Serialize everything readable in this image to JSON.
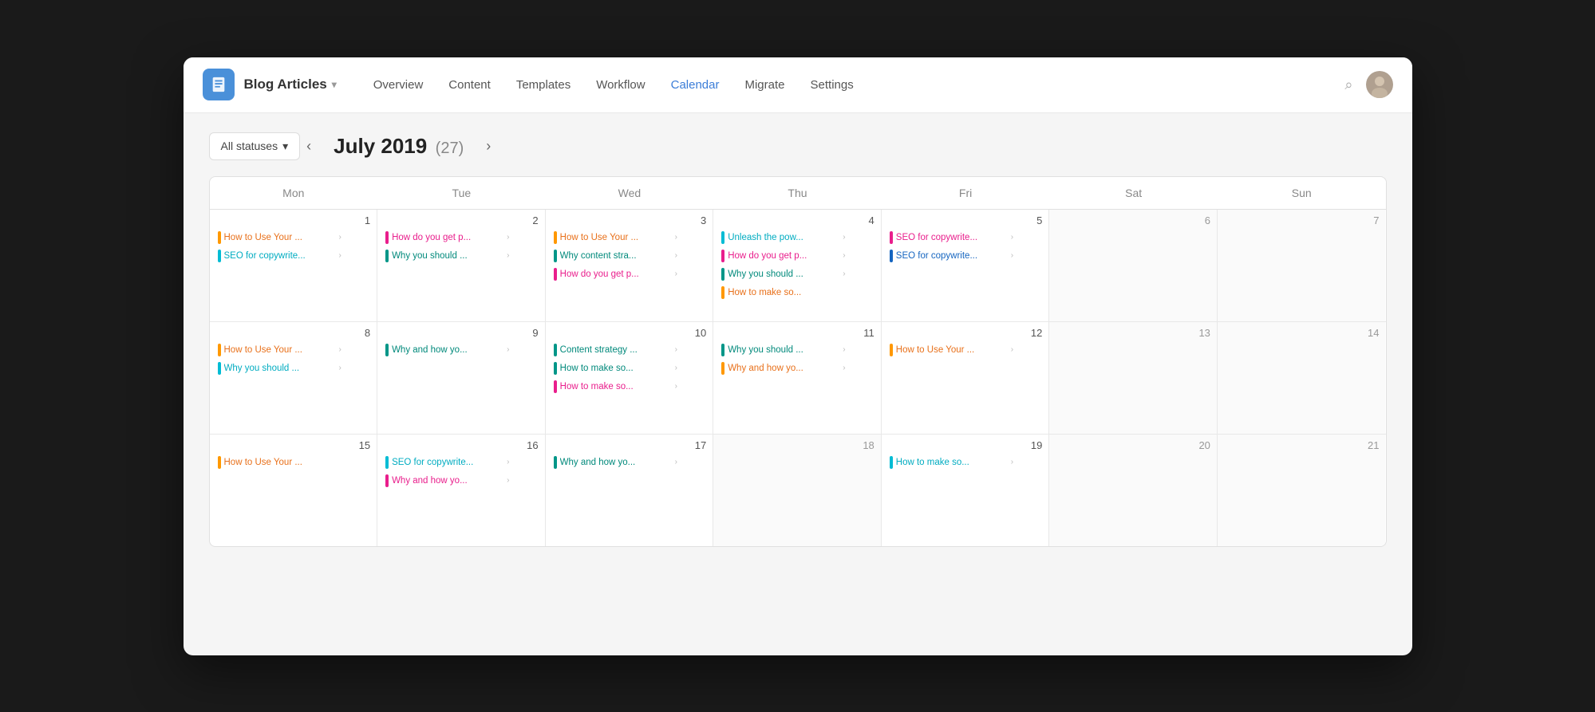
{
  "app": {
    "icon_label": "doc-icon",
    "title": "Blog Articles",
    "nav": [
      {
        "label": "Overview",
        "id": "overview",
        "active": false
      },
      {
        "label": "Content",
        "id": "content",
        "active": false
      },
      {
        "label": "Templates",
        "id": "templates",
        "active": false
      },
      {
        "label": "Workflow",
        "id": "workflow",
        "active": false
      },
      {
        "label": "Calendar",
        "id": "calendar",
        "active": true
      },
      {
        "label": "Migrate",
        "id": "migrate",
        "active": false
      },
      {
        "label": "Settings",
        "id": "settings",
        "active": false
      }
    ]
  },
  "filter": {
    "label": "All statuses",
    "arrow": "▾"
  },
  "calendar": {
    "month": "July 2019",
    "count": "(27)",
    "prev": "‹",
    "next": "›",
    "day_headers": [
      "Mon",
      "Tue",
      "Wed",
      "Thu",
      "Fri",
      "Sat",
      "Sun"
    ],
    "weeks": [
      {
        "days": [
          {
            "num": 1,
            "events": [
              {
                "bar": "bar-orange",
                "text": "How to Use Your ...",
                "color": "orange",
                "has_arrow": true
              },
              {
                "bar": "bar-cyan",
                "text": "SEO for copywrite...",
                "color": "cyan",
                "has_arrow": true
              }
            ]
          },
          {
            "num": 2,
            "events": [
              {
                "bar": "bar-pink",
                "text": "How do you get p...",
                "color": "pink",
                "has_arrow": true
              },
              {
                "bar": "bar-teal",
                "text": "Why you should ...",
                "color": "teal",
                "has_arrow": true
              }
            ]
          },
          {
            "num": 3,
            "events": [
              {
                "bar": "bar-orange",
                "text": "How to Use Your ...",
                "color": "orange",
                "has_arrow": true
              },
              {
                "bar": "bar-teal",
                "text": "Why content stra...",
                "color": "teal",
                "has_arrow": true
              },
              {
                "bar": "bar-pink",
                "text": "How do you get p...",
                "color": "pink",
                "has_arrow": true
              }
            ]
          },
          {
            "num": 4,
            "events": [
              {
                "bar": "bar-cyan",
                "text": "Unleash the pow...",
                "color": "cyan",
                "has_arrow": true
              },
              {
                "bar": "bar-pink",
                "text": "How do you get p...",
                "color": "pink",
                "has_arrow": true
              },
              {
                "bar": "bar-teal",
                "text": "Why you should ...",
                "color": "teal",
                "has_arrow": true
              },
              {
                "bar": "bar-orange",
                "text": "How to make so...",
                "color": "orange",
                "has_arrow": false
              }
            ]
          },
          {
            "num": 5,
            "events": [
              {
                "bar": "bar-pink",
                "text": "SEO for copywrite...",
                "color": "pink",
                "has_arrow": true
              },
              {
                "bar": "bar-blue",
                "text": "SEO for copywrite...",
                "color": "blue",
                "has_arrow": true
              }
            ]
          },
          {
            "num": 6,
            "events": []
          },
          {
            "num": 7,
            "events": []
          }
        ]
      },
      {
        "days": [
          {
            "num": 8,
            "events": [
              {
                "bar": "bar-orange",
                "text": "How to Use Your ...",
                "color": "orange",
                "has_arrow": true
              },
              {
                "bar": "bar-cyan",
                "text": "Why you should ...",
                "color": "cyan",
                "has_arrow": true
              }
            ]
          },
          {
            "num": 9,
            "events": [
              {
                "bar": "bar-teal",
                "text": "Why and how yo...",
                "color": "teal",
                "has_arrow": true
              }
            ]
          },
          {
            "num": 10,
            "events": [
              {
                "bar": "bar-teal",
                "text": "Content strategy ...",
                "color": "teal",
                "has_arrow": true
              },
              {
                "bar": "bar-teal",
                "text": "How to make so...",
                "color": "teal",
                "has_arrow": true
              },
              {
                "bar": "bar-pink",
                "text": "How to make so...",
                "color": "pink",
                "has_arrow": true
              }
            ]
          },
          {
            "num": 11,
            "events": [
              {
                "bar": "bar-teal",
                "text": "Why you should ...",
                "color": "teal",
                "has_arrow": true
              },
              {
                "bar": "bar-orange",
                "text": "Why and how yo...",
                "color": "orange",
                "has_arrow": true
              }
            ]
          },
          {
            "num": 12,
            "events": [
              {
                "bar": "bar-orange",
                "text": "How to Use Your ...",
                "color": "orange",
                "has_arrow": true
              }
            ]
          },
          {
            "num": 13,
            "events": []
          },
          {
            "num": 14,
            "events": []
          }
        ]
      },
      {
        "days": [
          {
            "num": 15,
            "events": [
              {
                "bar": "bar-orange",
                "text": "How to Use Your ...",
                "color": "orange",
                "has_arrow": false
              }
            ]
          },
          {
            "num": 16,
            "events": [
              {
                "bar": "bar-cyan",
                "text": "SEO for copywrite...",
                "color": "cyan",
                "has_arrow": true
              },
              {
                "bar": "bar-pink",
                "text": "Why and how yo...",
                "color": "pink",
                "has_arrow": true
              }
            ]
          },
          {
            "num": 17,
            "events": [
              {
                "bar": "bar-teal",
                "text": "Why and how yo...",
                "color": "teal",
                "has_arrow": true
              }
            ]
          },
          {
            "num": 18,
            "events": []
          },
          {
            "num": 19,
            "events": [
              {
                "bar": "bar-cyan",
                "text": "How to make so...",
                "color": "cyan",
                "has_arrow": true
              }
            ]
          },
          {
            "num": 20,
            "events": []
          },
          {
            "num": 21,
            "events": []
          }
        ]
      }
    ]
  }
}
